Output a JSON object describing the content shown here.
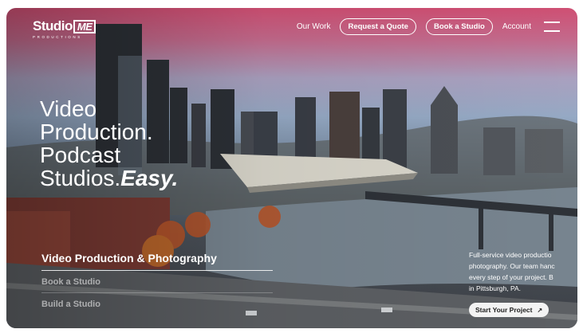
{
  "brand": {
    "logo_main": "Studio",
    "logo_box": "ME",
    "logo_sub": "PRODUCTIONS"
  },
  "nav": {
    "our_work": "Our Work",
    "request_quote": "Request a Quote",
    "book_studio": "Book a Studio",
    "account": "Account",
    "menu_icon": "hamburger-menu-icon"
  },
  "hero": {
    "line1": "Video",
    "line2": "Production.",
    "line3": "Podcast",
    "line4_prefix": "Studios.",
    "line4_emphasis": "Easy."
  },
  "services": {
    "items": [
      {
        "label": "Video Production & Photography"
      },
      {
        "label": "Book a Studio"
      },
      {
        "label": "Build a Studio"
      }
    ]
  },
  "description": {
    "line1": "Full-service video productio",
    "line2": "photography. Our team hanc",
    "line3": "every step of your project. B",
    "line4": "in Pittsburgh, PA."
  },
  "cta": {
    "label": "Start Your Project",
    "arrow": "↗"
  },
  "colors": {
    "sky_top": "#cf4f73",
    "sky_mid": "#95a9c4",
    "text": "#ffffff",
    "cta_bg": "#f3f3f3"
  }
}
